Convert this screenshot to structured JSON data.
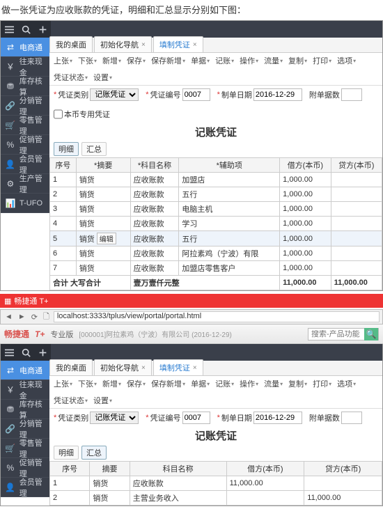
{
  "intro": "做一张凭证为应收账款的凭证，明细和汇总显示分别如下图：",
  "app1": {
    "sidebar": [
      "电商通",
      "往来现金",
      "库存核算",
      "分销管理",
      "零售管理",
      "促销管理",
      "会员管理",
      "生产管理",
      "T-UFO"
    ],
    "tabs": [
      {
        "label": "我的桌面",
        "closable": false
      },
      {
        "label": "初始化导航",
        "closable": true
      },
      {
        "label": "填制凭证",
        "closable": true,
        "active": true
      }
    ],
    "toolbar": [
      "上张",
      "下张",
      "新增",
      "保存",
      "保存新增",
      "单据",
      "记账",
      "操作",
      "流量",
      "复制",
      "打印",
      "选项",
      "凭证状态",
      "设置"
    ],
    "meta": {
      "type_lbl": "凭证类别",
      "type_val": "记账凭证",
      "no_lbl": "凭证编号",
      "no_val": "0007",
      "date_lbl": "制单日期",
      "date_val": "2016-12-29",
      "att_lbl": "附单据数",
      "att_val": "",
      "flag_lbl": "本币专用凭证",
      "flag_val": false
    },
    "doc_title": "记账凭证",
    "subtabs": [
      {
        "label": "明细",
        "active": true
      },
      {
        "label": "汇总",
        "active": false
      }
    ],
    "grid": {
      "cols": [
        "序号",
        "*摘要",
        "*科目名称",
        "*辅助项",
        "借方(本币)",
        "贷方(本币)"
      ],
      "rows": [
        {
          "n": "1",
          "s": "销货",
          "a": "应收账款",
          "x": "加盟店",
          "d": "1,000.00",
          "c": ""
        },
        {
          "n": "2",
          "s": "销货",
          "a": "应收账款",
          "x": "五行",
          "d": "1,000.00",
          "c": ""
        },
        {
          "n": "3",
          "s": "销货",
          "a": "应收账款",
          "x": "电脑主机",
          "d": "1,000.00",
          "c": ""
        },
        {
          "n": "4",
          "s": "销货",
          "a": "应收账款",
          "x": "学习",
          "d": "1,000.00",
          "c": ""
        },
        {
          "n": "5",
          "s": "销货",
          "a": "应收账款",
          "x": "五行",
          "d": "1,000.00",
          "c": "",
          "hl": true,
          "editing": true
        },
        {
          "n": "6",
          "s": "销货",
          "a": "应收账款",
          "x": "阿拉素鸡（宁波）有限",
          "d": "1,000.00",
          "c": ""
        },
        {
          "n": "7",
          "s": "销货",
          "a": "应收账款",
          "x": "加盟店零售客户",
          "d": "1,000.00",
          "c": ""
        }
      ],
      "total": {
        "lbl": "合计 大写合计",
        "words": "壹万壹仟元整",
        "d": "11,000.00",
        "c": "11,000.00"
      }
    }
  },
  "browser": {
    "wintitle": "畅捷通 T+",
    "url": "localhost:3333/tplus/view/portal/portal.html",
    "brand": "畅捷通",
    "brand_sup": "T+",
    "edition": "专业版",
    "org": "[000001]阿拉素鸡（宁波）有限公司   (2016-12-29)",
    "search_ph": "搜索-产品功能"
  },
  "app2": {
    "sidebar": [
      "电商通",
      "往来现金",
      "库存核算",
      "分销管理",
      "零售管理",
      "促销管理",
      "会员管理"
    ],
    "tabs": [
      {
        "label": "我的桌面",
        "closable": false
      },
      {
        "label": "初始化导航",
        "closable": true
      },
      {
        "label": "填制凭证",
        "closable": true,
        "active": true
      }
    ],
    "toolbar": [
      "上张",
      "下张",
      "新增",
      "保存",
      "保存新增",
      "单据",
      "记账",
      "操作",
      "流量",
      "复制",
      "打印",
      "选项",
      "凭证状态",
      "设置"
    ],
    "meta": {
      "type_lbl": "凭证类别",
      "type_val": "记账凭证",
      "no_lbl": "凭证编号",
      "no_val": "0007",
      "date_lbl": "制单日期",
      "date_val": "2016-12-29",
      "att_lbl": "附单据数",
      "att_val": ""
    },
    "doc_title": "记账凭证",
    "subtabs": [
      {
        "label": "明细",
        "active": false
      },
      {
        "label": "汇总",
        "active": true
      }
    ],
    "grid": {
      "cols": [
        "序号",
        "摘要",
        "科目名称",
        "借方(本币)",
        "贷方(本币)"
      ],
      "rows": [
        {
          "n": "1",
          "s": "销货",
          "a": "应收账款",
          "d": "11,000.00",
          "c": ""
        },
        {
          "n": "2",
          "s": "销货",
          "a": "主营业务收入",
          "d": "",
          "c": "11,000.00"
        }
      ]
    }
  }
}
